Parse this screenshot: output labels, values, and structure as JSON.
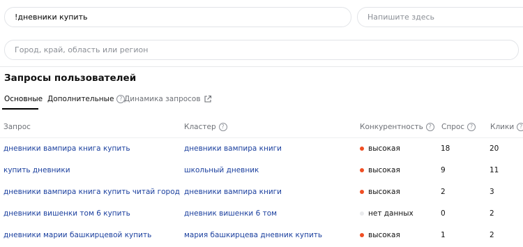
{
  "search": {
    "query": "!дневники купить",
    "note_placeholder": "Напишите здесь",
    "region_placeholder": "Город, край, область или регион"
  },
  "section": {
    "title": "Запросы пользователей"
  },
  "tabs": [
    {
      "label": "Основные"
    },
    {
      "label": "Дополнительные"
    },
    {
      "label": "Динамика запросов"
    }
  ],
  "table": {
    "headers": {
      "query": "Запрос",
      "cluster": "Кластер",
      "competition": "Конкурентность",
      "demand": "Спрос",
      "clicks": "Клики"
    },
    "help_glyph": "?",
    "rows": [
      {
        "query": "дневники вампира книга купить",
        "cluster": "дневники вампира книги",
        "competition": "высокая",
        "demand": "18",
        "clicks": "20"
      },
      {
        "query": "купить дневники",
        "cluster": "школьный дневник",
        "competition": "высокая",
        "demand": "9",
        "clicks": "11"
      },
      {
        "query": "дневники вампира книга купить читай город",
        "cluster": "дневники вампира книги",
        "competition": "высокая",
        "demand": "2",
        "clicks": "3"
      },
      {
        "query": "дневники вишенки том 6 купить",
        "cluster": "дневник вишенки 6 том",
        "competition": "нет данных",
        "demand": "0",
        "clicks": "2"
      },
      {
        "query": "дневники марии башкирцевой купить",
        "cluster": "мария башкирцева дневник купить",
        "competition": "высокая",
        "demand": "1",
        "clicks": "2"
      }
    ]
  },
  "colors": {
    "high": "#f04e23",
    "none": "#e9eaec",
    "link": "#1a3f9e"
  }
}
